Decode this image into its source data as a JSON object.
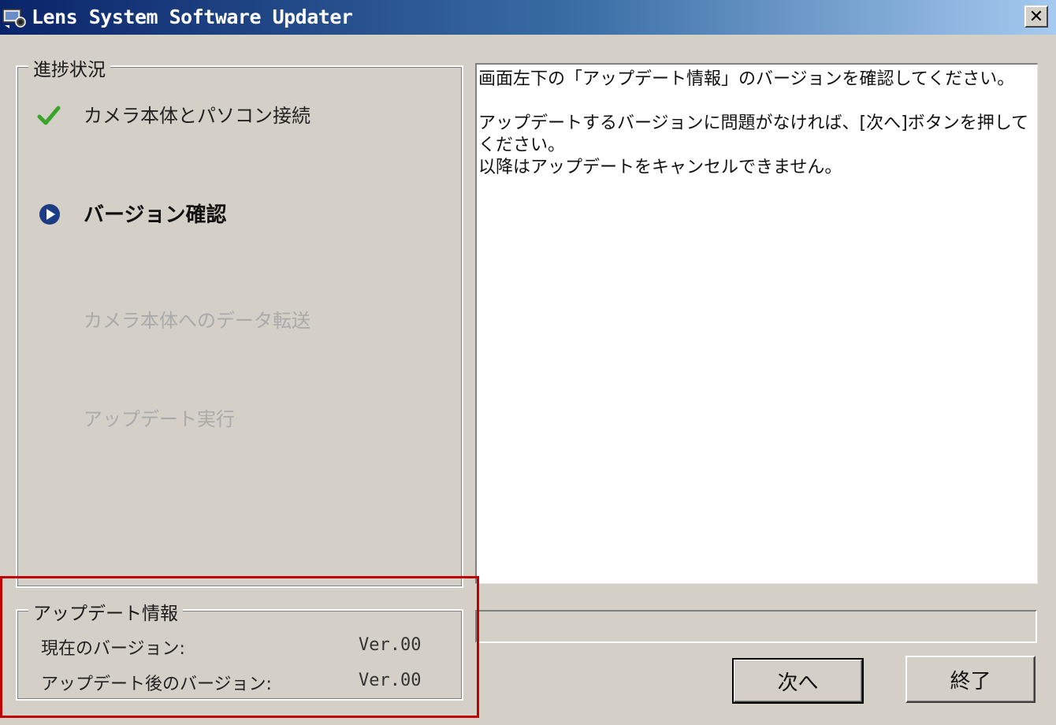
{
  "window": {
    "title": "Lens System Software Updater",
    "close_label": "✕"
  },
  "progress_group": {
    "legend": "進捗状況",
    "steps": [
      {
        "label": "カメラ本体とパソコン接続",
        "status": "done"
      },
      {
        "label": "バージョン確認",
        "status": "current"
      },
      {
        "label": "カメラ本体へのデータ転送",
        "status": "pending"
      },
      {
        "label": "アップデート実行",
        "status": "pending"
      }
    ]
  },
  "message": {
    "line1": "画面左下の「アップデート情報」のバージョンを確認してください。",
    "line2": "アップデートするバージョンに問題がなければ、[次へ]ボタンを押してください。",
    "line3": "以降はアップデートをキャンセルできません。"
  },
  "progress_bar": {
    "value": 0
  },
  "update_info": {
    "legend": "アップデート情報",
    "current_label": "現在のバージョン:",
    "current_value": "Ver.00",
    "after_label": "アップデート後のバージョン:",
    "after_value": "Ver.00"
  },
  "buttons": {
    "next_label": "次へ",
    "exit_label": "終了"
  },
  "colors": {
    "window_bg": "#d4d0c8",
    "titlebar_start": "#0a246a",
    "titlebar_end": "#a6caf0",
    "check_green": "#3aa52a",
    "current_arrow": "#1c3c84",
    "pending_text": "#aaaaaa",
    "highlight_red": "#c00000"
  },
  "icons": {
    "app": "lens-updater-icon",
    "done": "check-icon",
    "current": "play-circle-icon",
    "close": "close-icon"
  }
}
